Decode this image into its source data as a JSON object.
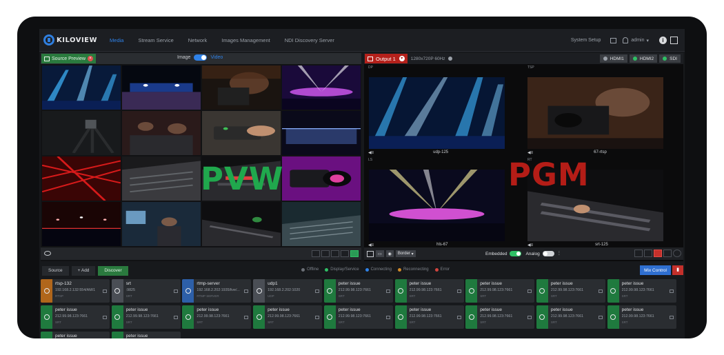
{
  "nav": {
    "brand": "KILOVIEW",
    "items": [
      "Media",
      "Stream Service",
      "Network",
      "Images Management",
      "NDI Discovery Server"
    ],
    "active_index": 0,
    "system_setup": "System Setup",
    "user": "admin",
    "info_glyph": "i",
    "accent_color": "#2f82e8"
  },
  "pvw": {
    "source_preview_label": "Source Preview",
    "toggle_left": "Image",
    "toggle_right": "Video",
    "big_label": "PVW",
    "big_label_color": "#20a84d"
  },
  "pgm": {
    "output_label": "Output 1",
    "resolution": "1280x720P 60Hz",
    "ports": [
      "HDMI1",
      "HDMI2",
      "SDI"
    ],
    "tiles": [
      {
        "name": "udp-125",
        "tag": "DP"
      },
      {
        "name": "67-rtsp",
        "tag": "TSP"
      },
      {
        "name": "hls-67",
        "tag": "LS"
      },
      {
        "name": "srt-125",
        "tag": "RT"
      }
    ],
    "big_label": "PGM",
    "big_label_color": "#b41d17",
    "border_label": "Border",
    "embedded_label": "Embedded",
    "analog_label": "Analog"
  },
  "source_bar": {
    "source_label": "Source",
    "add_label": "+ Add",
    "discover_label": "Discover",
    "legend": [
      {
        "label": "Offline",
        "color": "#6b6f76"
      },
      {
        "label": "Display/Service",
        "color": "#2fbf65"
      },
      {
        "label": "Connecting",
        "color": "#2f82e8"
      },
      {
        "label": "Reconnecting",
        "color": "#d08a2a"
      },
      {
        "label": "Error",
        "color": "#d0443e"
      }
    ],
    "mix_control_label": "Mix Control"
  },
  "sources": [
    {
      "name": "rtsp-132",
      "ip": "192.168.2.132:554/AM/1",
      "sub": "RTSP",
      "color": "orange"
    },
    {
      "name": "srt",
      "ip": ":9825",
      "sub": "SRT",
      "color": "gray"
    },
    {
      "name": "rtmp-server",
      "ip": "192.168.2.202:1935/live/...",
      "sub": "RTMP SERVER",
      "color": "blue"
    },
    {
      "name": "udp1",
      "ip": "192.168.2.202:1020",
      "sub": "UDP",
      "color": "gray"
    },
    {
      "name": "peter issue",
      "ip": "212.99.98.123:7661",
      "sub": "SRT",
      "color": "green"
    },
    {
      "name": "peter issue",
      "ip": "212.99.98.123:7661",
      "sub": "SRT",
      "color": "green"
    },
    {
      "name": "peter issue",
      "ip": "212.99.98.123:7661",
      "sub": "SRT",
      "color": "green"
    },
    {
      "name": "peter issue",
      "ip": "212.99.98.123:7661",
      "sub": "SRT",
      "color": "green"
    },
    {
      "name": "peter issue",
      "ip": "212.99.98.123:7661",
      "sub": "SRT",
      "color": "green"
    },
    {
      "name": "peter issue",
      "ip": "212.99.98.123:7661",
      "sub": "SRT",
      "color": "green"
    },
    {
      "name": "peter issue",
      "ip": "212.99.98.123:7661",
      "sub": "SRT",
      "color": "green"
    },
    {
      "name": "peter issue",
      "ip": "212.99.98.123:7661",
      "sub": "SRT",
      "color": "green"
    },
    {
      "name": "peter issue",
      "ip": "212.99.98.123:7661",
      "sub": "SRT",
      "color": "green"
    },
    {
      "name": "peter issue",
      "ip": "212.99.98.123:7661",
      "sub": "SRT",
      "color": "green"
    },
    {
      "name": "peter issue",
      "ip": "212.99.98.123:7661",
      "sub": "SRT",
      "color": "green"
    },
    {
      "name": "peter issue",
      "ip": "212.99.98.123:7661",
      "sub": "SRT",
      "color": "green"
    },
    {
      "name": "peter issue",
      "ip": "212.99.98.123:7661",
      "sub": "SRT",
      "color": "green"
    },
    {
      "name": "peter issue",
      "ip": "212.99.98.123:7661",
      "sub": "SRT",
      "color": "green"
    },
    {
      "name": "peter issue",
      "ip": "",
      "sub": "",
      "color": "green"
    },
    {
      "name": "peter issue",
      "ip": "",
      "sub": "",
      "color": "green"
    }
  ]
}
